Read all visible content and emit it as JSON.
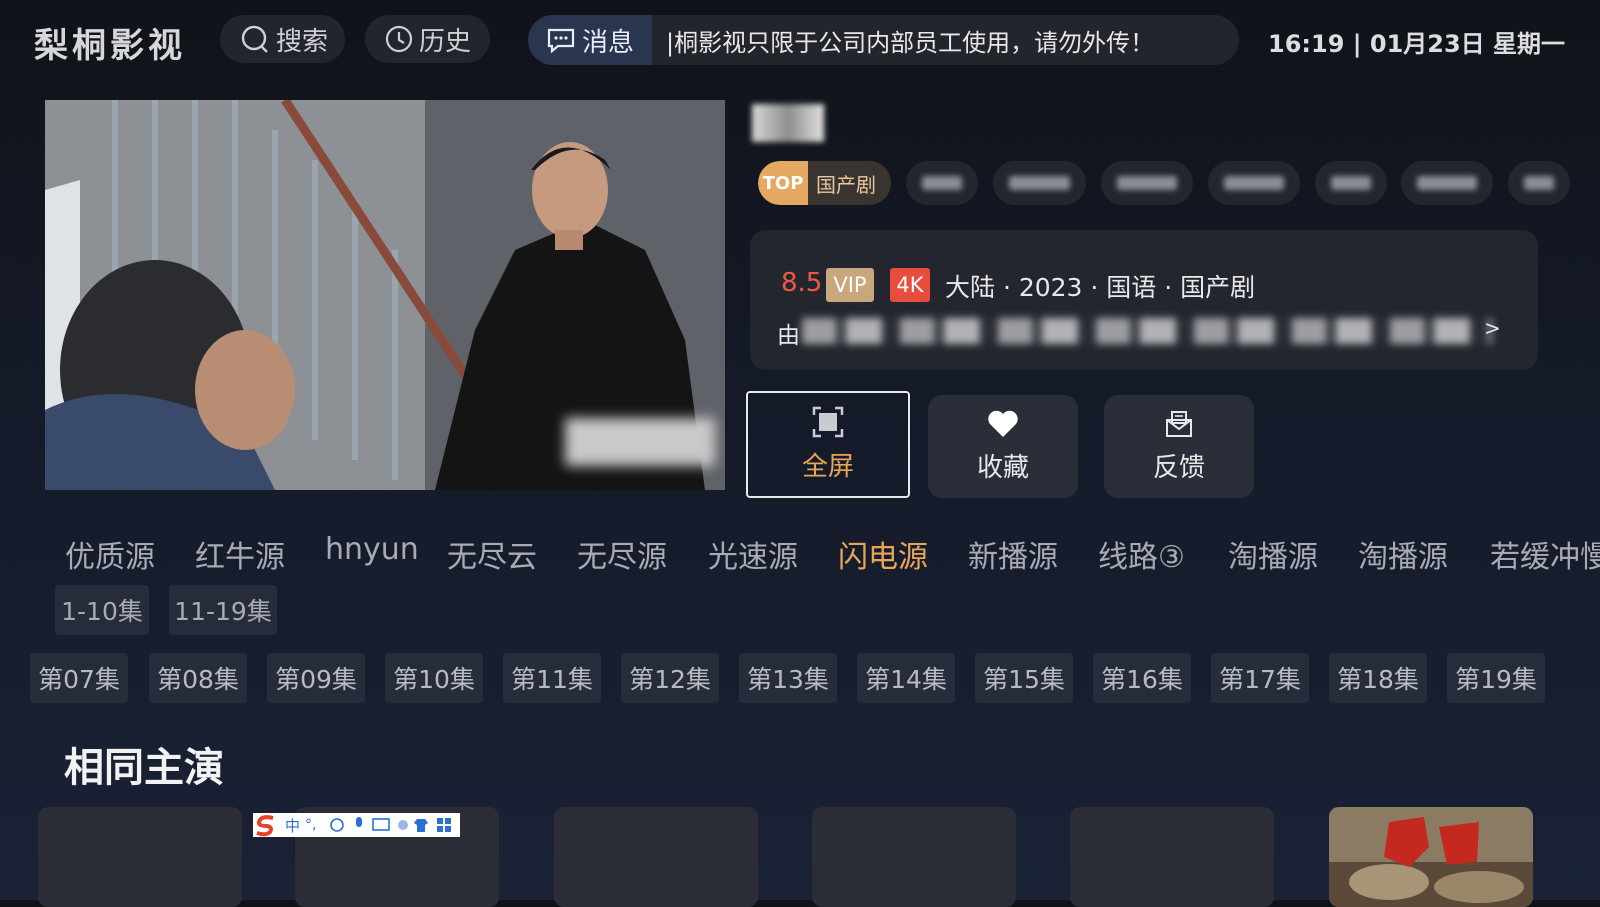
{
  "header": {
    "logo": "梨桐影视",
    "search_label": "搜索",
    "history_label": "历史",
    "message_tag": "消息",
    "message_text": "|桐影视只限于公司内部员工使用，请勿外传！",
    "clock": "16:19 | 01月23日  星期一"
  },
  "detail": {
    "top_badge": "TOP",
    "category_tag": "国产剧",
    "rating": "8.5",
    "vip_badge": "VIP",
    "quality_badge": "4K",
    "meta": "大陆 · 2023 · 国语 · 国产剧",
    "cast_prefix": "由",
    "cast_more": ">"
  },
  "actions": {
    "fullscreen": "全屏",
    "favorite": "收藏",
    "feedback": "反馈"
  },
  "sources": [
    "优质源",
    "红牛源",
    "hnyun",
    "无尽云",
    "无尽源",
    "光速源",
    "闪电源",
    "新播源",
    "线路③",
    "淘播源",
    "淘播源",
    "若缓冲慢或"
  ],
  "active_source": "闪电源",
  "episode_ranges": [
    "1-10集",
    "11-19集"
  ],
  "episodes": [
    "第07集",
    "第08集",
    "第09集",
    "第10集",
    "第11集",
    "第12集",
    "第13集",
    "第14集",
    "第15集",
    "第16集",
    "第17集",
    "第18集",
    "第19集"
  ],
  "section_title": "相同主演",
  "colors": {
    "accent": "#e7a558",
    "rating": "#f0593f",
    "vip": "#c8a77c",
    "quality": "#e74c3c"
  }
}
